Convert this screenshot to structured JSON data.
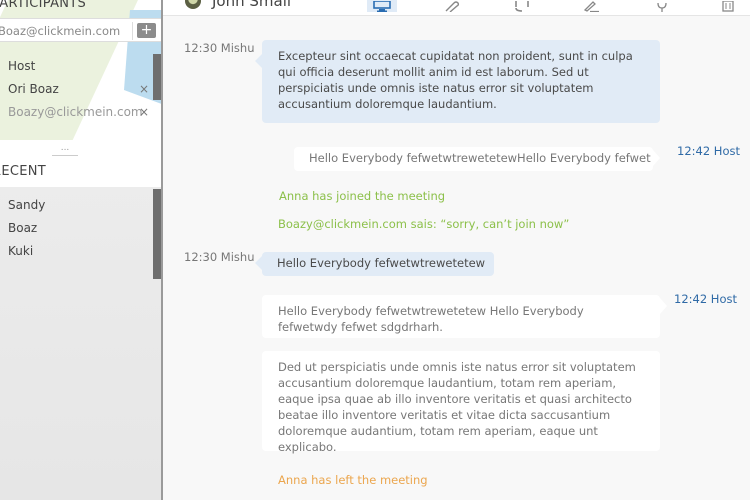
{
  "sidebar": {
    "participants_title": "PARTICIPANTS",
    "invite_placeholder": "Boaz@clickmein.com",
    "invite_value": "Boaz@clickmein.com",
    "add_label": "+",
    "participants": [
      {
        "name": "Host",
        "removable": false,
        "pending": false
      },
      {
        "name": "Ori Boaz",
        "removable": true,
        "pending": false
      },
      {
        "name": "Boazy@clickmein.com",
        "removable": true,
        "pending": true
      }
    ],
    "remove_glyph": "×",
    "more_label": "...",
    "recent_title": "RECENT",
    "recent": [
      "Sandy",
      "Boaz",
      "Kuki"
    ]
  },
  "topbar": {
    "contact_name": "John Smail",
    "tools": [
      {
        "name": "screen-share",
        "active": true
      },
      {
        "name": "attach",
        "active": false
      },
      {
        "name": "headset",
        "active": false
      },
      {
        "name": "pen",
        "active": false
      },
      {
        "name": "microphone",
        "active": false
      },
      {
        "name": "trash",
        "active": false
      }
    ]
  },
  "chat": {
    "messages": [
      {
        "type": "incoming",
        "meta": "12:30 Mishu",
        "text": "Excepteur sint occaecat cupidatat non proident, sunt in culpa qui officia deserunt mollit anim id est laborum. Sed ut perspiciatis unde omnis iste natus error sit voluptatem accusantium doloremque laudantium."
      },
      {
        "type": "outgoing",
        "meta": "12:42 Host",
        "text": "Hello Everybody  fefwetwtrewetetewHello Everybody  fefwet"
      },
      {
        "type": "system-join",
        "text": "Anna has joined the meeting"
      },
      {
        "type": "system-join",
        "text": "Boazy@clickmein.com sais: “sorry, can’t join now”"
      },
      {
        "type": "incoming",
        "meta": "12:30 Mishu",
        "text": "Hello Everybody  fefwetwtrewetetew"
      },
      {
        "type": "outgoing",
        "meta": "12:42 Host",
        "text": "Hello Everybody  fefwetwtrewetetew Hello Everybody  fefwetwdy fefwet sdgdrharh."
      },
      {
        "type": "outgoing-cont",
        "text": "Ded ut perspiciatis unde omnis iste natus error sit voluptatem accusantium doloremque laudantium, totam rem aperiam, eaque ipsa quae ab illo inventore veritatis et quasi architecto beatae illo inventore veritatis et vitae dicta saccusantium doloremque audantium, totam rem aperiam, eaque unt explicabo."
      },
      {
        "type": "system-leave",
        "text": "Anna has left the meeting"
      }
    ]
  },
  "colors": {
    "host_meta": "#2f6aa6",
    "incoming_bubble": "#e1ebf6",
    "join": "#8cc04a",
    "leave": "#eba64e"
  }
}
